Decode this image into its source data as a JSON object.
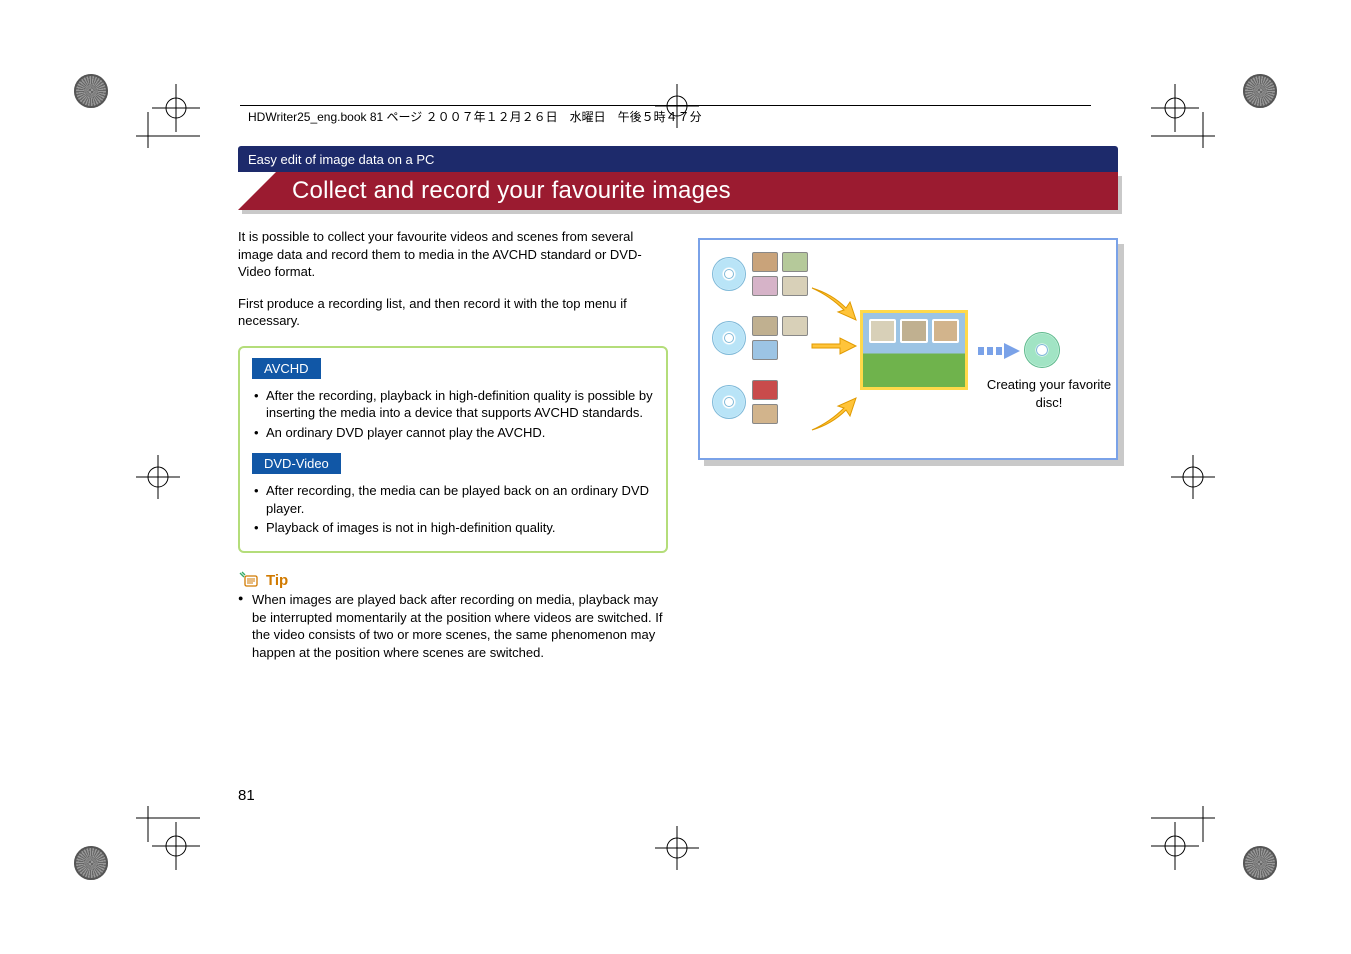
{
  "header": {
    "file_info": "HDWriter25_eng.book  81 ページ  ２００７年１２月２６日　水曜日　午後５時４７分"
  },
  "section": {
    "breadcrumb": "Easy edit of image data on a PC",
    "title": "Collect and record your favourite images"
  },
  "intro": {
    "p1": "It is possible to collect your favourite videos and scenes from several image data and record them to media in the AVCHD standard or DVD-Video format.",
    "p2": "First produce a recording list, and then record it with the top menu if necessary."
  },
  "avchd": {
    "label": "AVCHD",
    "items": [
      "After the recording, playback in high-definition quality is possible by inserting the media into a device that supports AVCHD standards.",
      "An ordinary DVD player cannot play the AVCHD."
    ]
  },
  "dvd": {
    "label": "DVD-Video",
    "items": [
      "After recording, the media can be played back on an ordinary DVD player.",
      "Playback of images is not in high-definition quality."
    ]
  },
  "tip": {
    "label": "Tip",
    "items": [
      "When images are played back after recording on media, playback may be interrupted momentarily at the position where videos are switched. If the video consists of two or more scenes, the same phenomenon may happen at the position where scenes are switched."
    ]
  },
  "diagram": {
    "caption": "Creating your favorite disc!"
  },
  "page_number": "81"
}
